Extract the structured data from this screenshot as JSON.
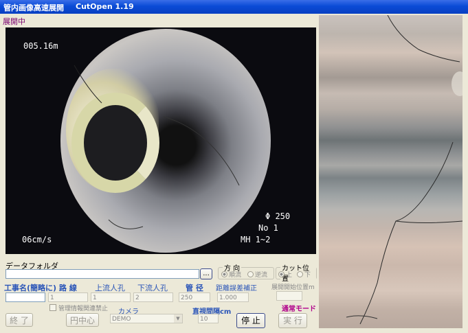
{
  "titlebar": {
    "app_title": "管内画像高速展開",
    "version": "CutOpen 1.19"
  },
  "status": "展開中",
  "video": {
    "distance": "005.16m",
    "speed": "06cm/s",
    "diameter": "Φ 250",
    "number": "No 1",
    "manhole": "MH 1~2"
  },
  "form": {
    "data_folder_label": "データフォルダ",
    "data_folder_value": "",
    "browse_label": "...",
    "direction": {
      "label": "方 向",
      "options": [
        "順流",
        "逆流"
      ],
      "selected": 0
    },
    "cut_position": {
      "label": "カット位置",
      "options": [
        "上",
        "下"
      ],
      "selected": 0
    },
    "project_label": "工事名(簡略に)",
    "route_label": "路 線",
    "upstream_label": "上流人孔",
    "downstream_label": "下流人孔",
    "pipe_diameter_label": "管 径",
    "distance_error_label": "距離誤差補正",
    "start_pos_label": "展開開始位置m",
    "project_value": "",
    "route_value": "1",
    "upstream_value": "1",
    "downstream_value": "2",
    "pipe_diameter_value": "250",
    "distance_error_value": "1.000",
    "start_pos_value": "",
    "mgmt_checkbox_label": "管理情報関連禁止",
    "camera_label": "カメラ",
    "camera_value": "DEMO",
    "visual_interval_label": "直視間隔cm",
    "visual_interval_value": "10",
    "mode_label": "通常モード"
  },
  "buttons": {
    "exit": "終 了",
    "center": "円中心",
    "stop": "停 止",
    "run": "実 行"
  }
}
